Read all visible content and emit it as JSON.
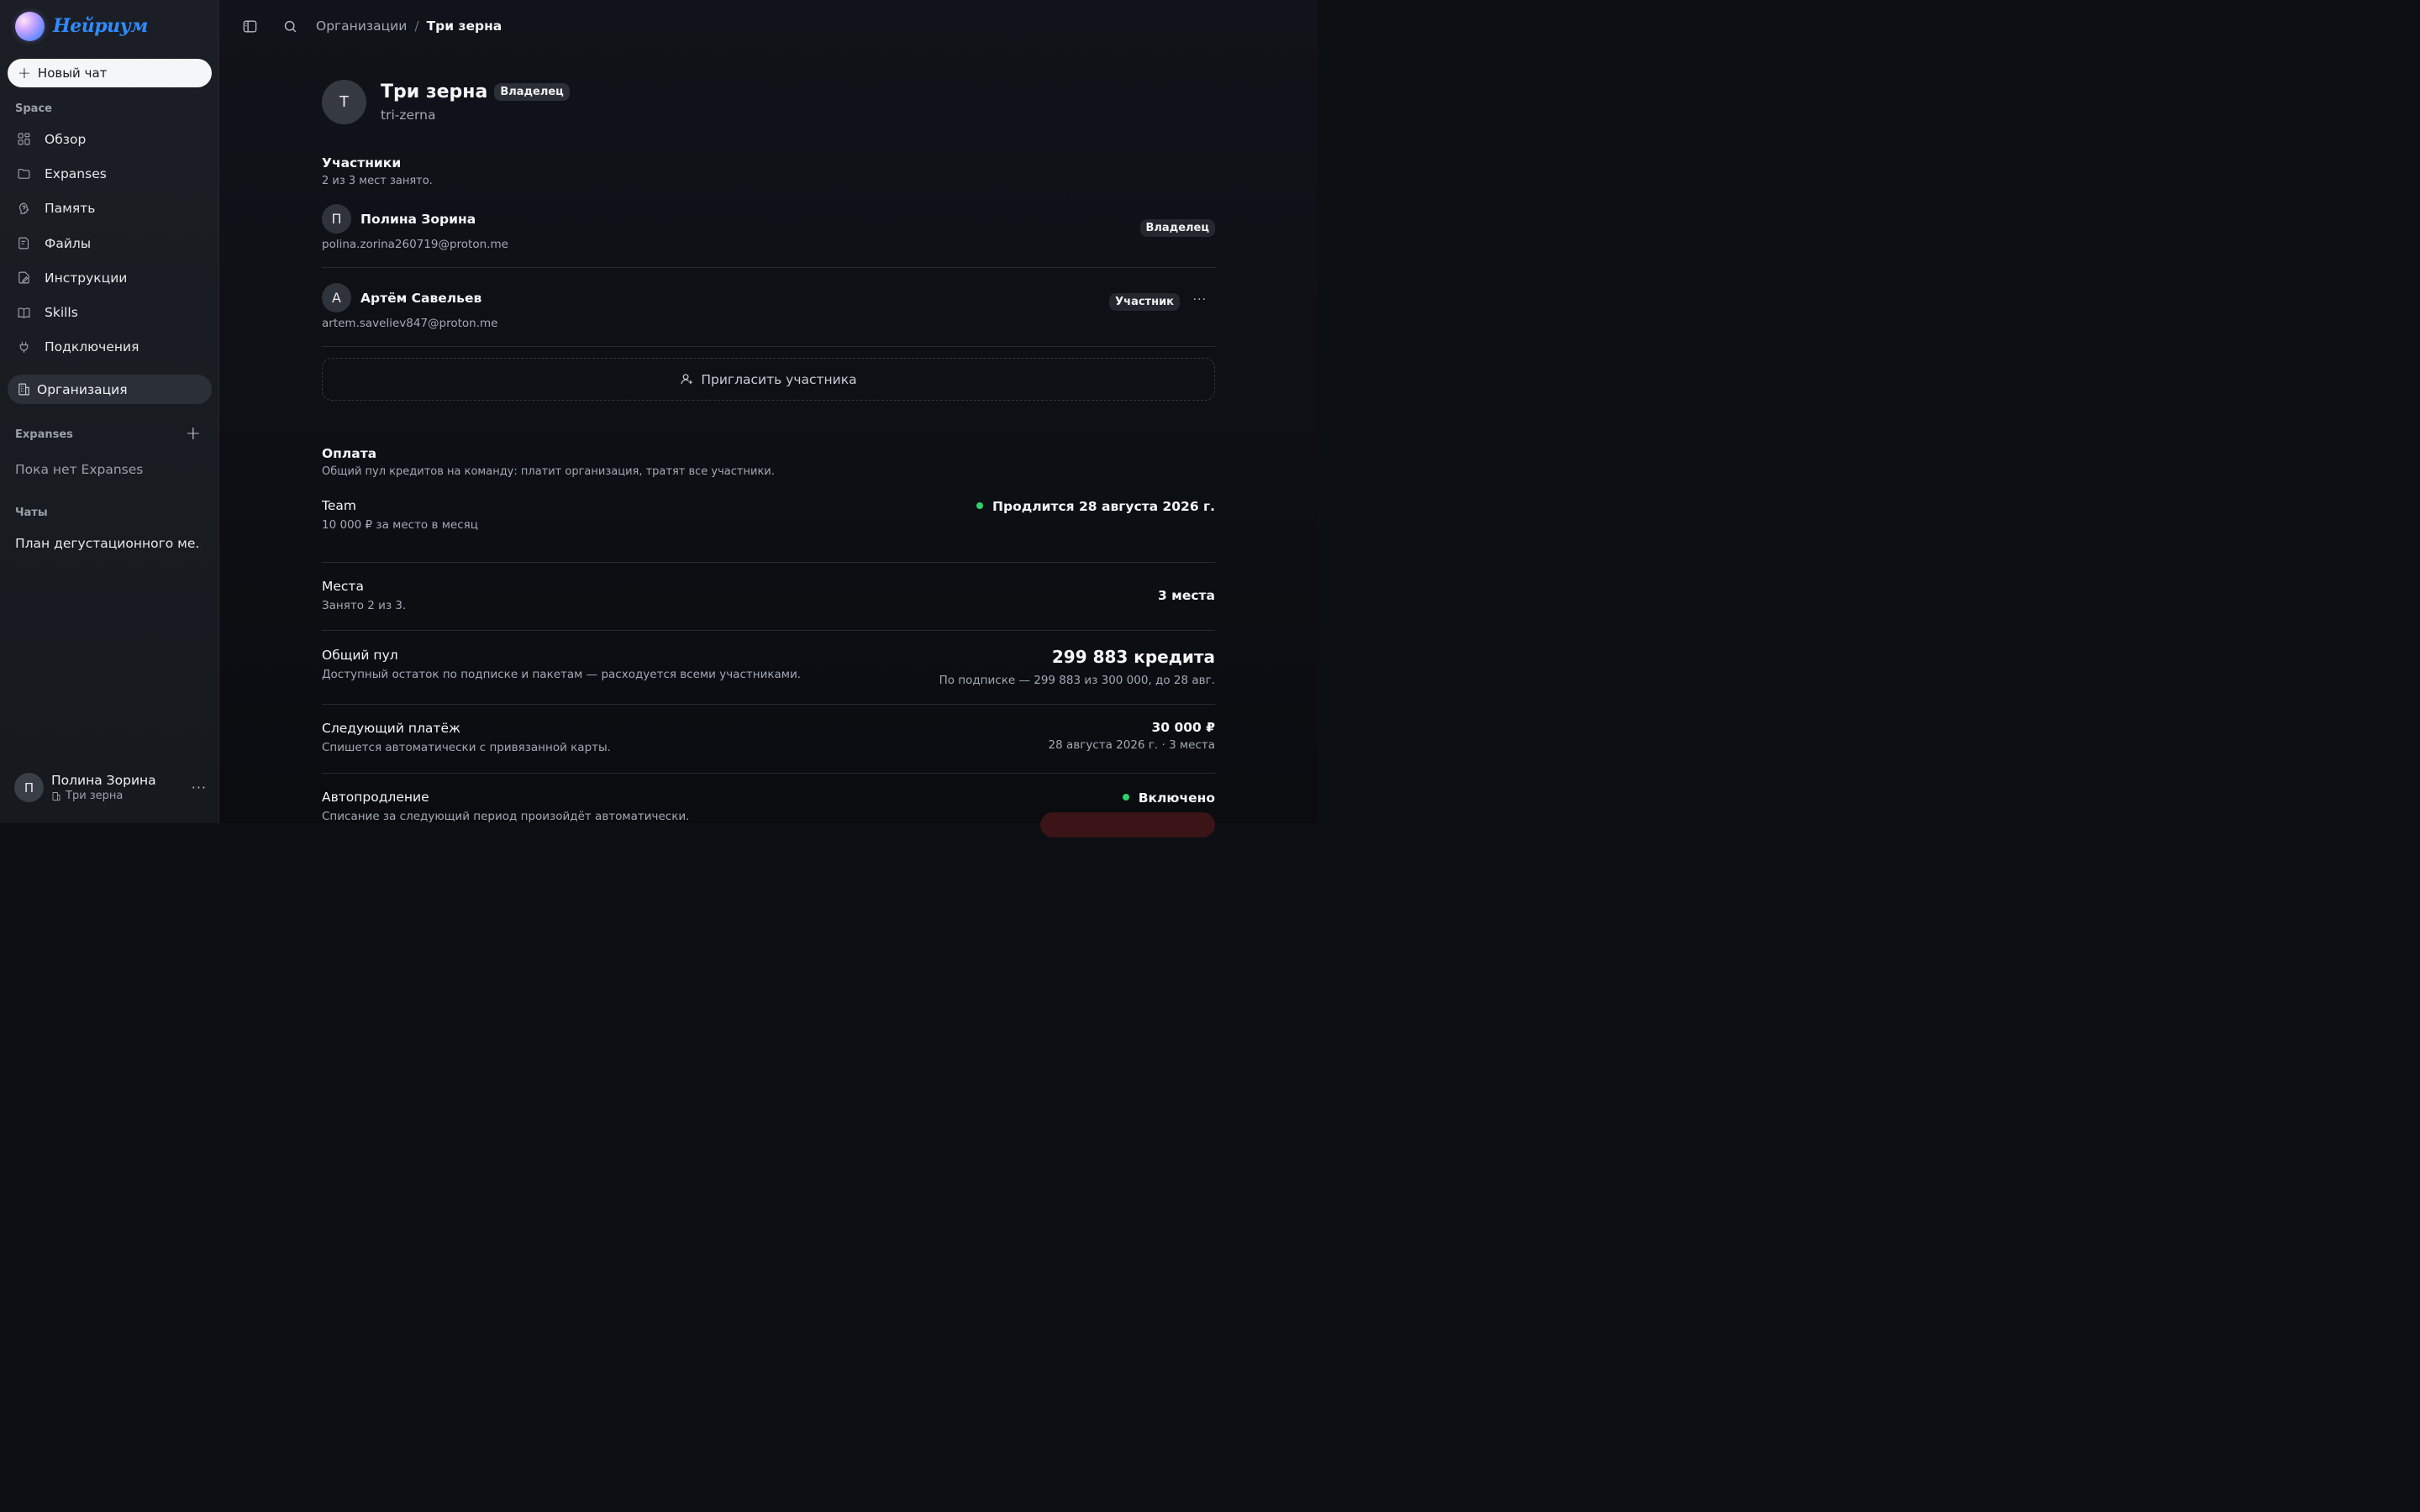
{
  "brand": {
    "name": "Нейриум"
  },
  "sidebar": {
    "new_chat": "Новый чат",
    "space_label": "Space",
    "items": [
      {
        "label": "Обзор",
        "icon": "grid-icon"
      },
      {
        "label": "Expanses",
        "icon": "folder-icon"
      },
      {
        "label": "Память",
        "icon": "brain-icon"
      },
      {
        "label": "Файлы",
        "icon": "file-icon"
      },
      {
        "label": "Инструкции",
        "icon": "instructions-icon"
      },
      {
        "label": "Skills",
        "icon": "book-icon"
      },
      {
        "label": "Подключения",
        "icon": "plug-icon"
      }
    ],
    "org_item": "Организация",
    "expanses_label": "Expanses",
    "expanses_empty": "Пока нет Expanses",
    "chats_label": "Чаты",
    "chats": [
      "План дегустационного ме..."
    ],
    "user": {
      "initial": "П",
      "name": "Полина Зорина",
      "org": "Три зерна"
    }
  },
  "breadcrumb": {
    "parent": "Организации",
    "separator": "/",
    "current": "Три зерна"
  },
  "org": {
    "initial": "Т",
    "name": "Три зерна",
    "role_badge": "Владелец",
    "slug": "tri-zerna"
  },
  "members": {
    "title": "Участники",
    "subtitle": "2 из 3 мест занято.",
    "list": [
      {
        "initial": "П",
        "name": "Полина Зорина",
        "email": "polina.zorina260719@proton.me",
        "role": "Владелец"
      },
      {
        "initial": "А",
        "name": "Артём Савельев",
        "email": "artem.saveliev847@proton.me",
        "role": "Участник"
      }
    ],
    "invite": "Пригласить участника"
  },
  "billing": {
    "title": "Оплата",
    "subtitle": "Общий пул кредитов на команду: платит организация, тратят все участники.",
    "plan": {
      "name": "Team",
      "desc": "10 000 ₽ за место в месяц",
      "status": "Продлится 28 августа 2026 г.",
      "status_color": "#2fd06a"
    },
    "seats": {
      "name": "Места",
      "desc": "Занято 2 из 3.",
      "value": "3 места"
    },
    "pool": {
      "name": "Общий пул",
      "desc": "Доступный остаток по подписке и пакетам — расходуется всеми участниками.",
      "value": "299 883 кредита",
      "detail": "По подписке — 299 883 из 300 000, до 28 авг."
    },
    "next_payment": {
      "name": "Следующий платёж",
      "desc": "Спишется автоматически с привязанной карты.",
      "value": "30 000 ₽",
      "detail": "28 августа 2026 г. · 3 места"
    },
    "autorenew": {
      "name": "Автопродление",
      "desc": "Списание за следующий период произойдёт автоматически.",
      "status": "Включено",
      "status_color": "#2fd06a"
    }
  }
}
